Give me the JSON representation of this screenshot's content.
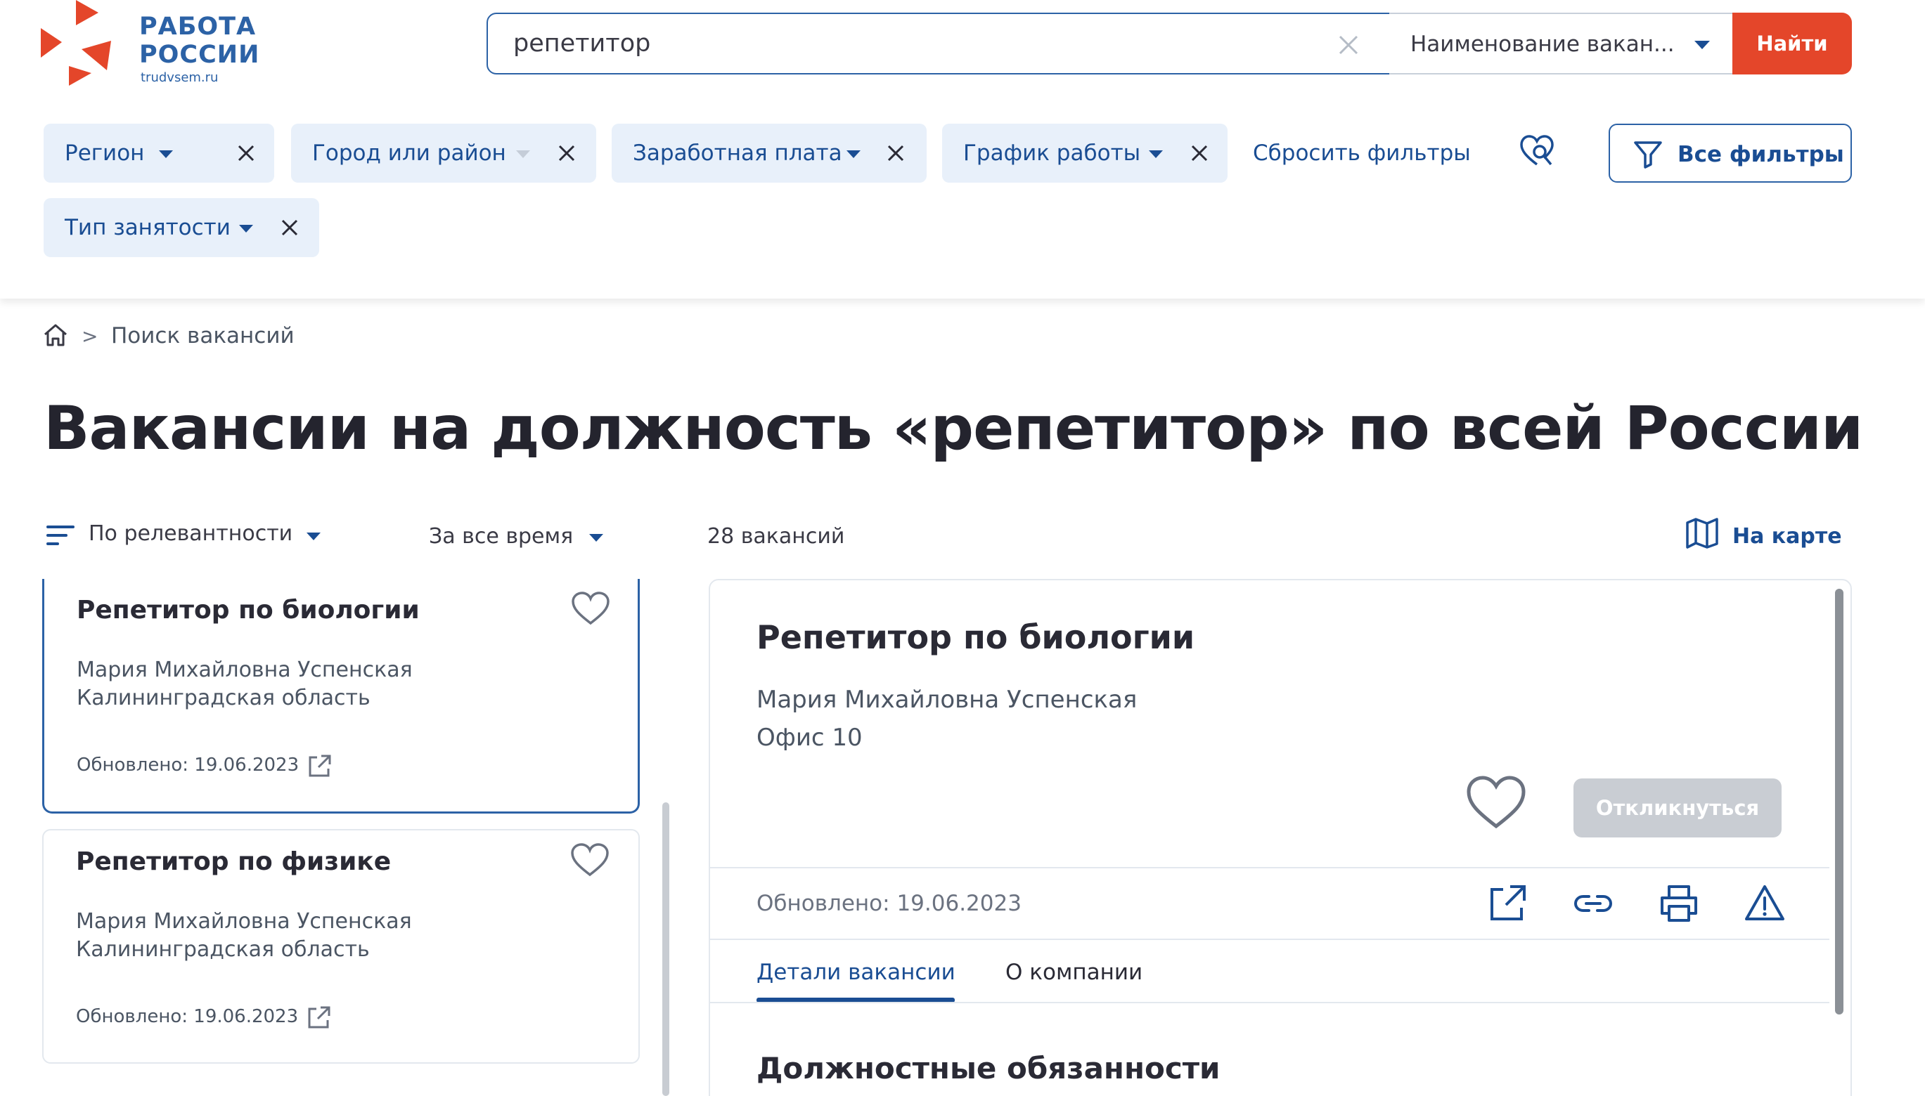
{
  "brand": {
    "line1": "РАБОТА",
    "line2": "РОССИИ",
    "domain": "trudvsem.ru",
    "accent": "#e4462a",
    "primary": "#2c62a6"
  },
  "search": {
    "value": "репетитор",
    "type_label": "Наименование вакан...",
    "button": "Найти"
  },
  "filters": {
    "chips": [
      {
        "label": "Регион"
      },
      {
        "label": "Город или район"
      },
      {
        "label": "Заработная плата"
      },
      {
        "label": "График работы"
      },
      {
        "label": "Тип занятости"
      }
    ],
    "reset": "Сбросить фильтры",
    "all": "Все фильтры"
  },
  "breadcrumb": {
    "current": "Поиск вакансий",
    "separator": ">"
  },
  "page_title": "Вакансии на должность «репетитор» по всей России",
  "controls": {
    "sort": "По релевантности",
    "period": "За все время",
    "count": "28 вакансий",
    "map": "На карте"
  },
  "vacancies": [
    {
      "title": "Репетитор по биологии",
      "company": "Мария Михайловна Успенская",
      "region": "Калининградская область",
      "updated": "Обновлено: 19.06.2023"
    },
    {
      "title": "Репетитор по физике",
      "company": "Мария Михайловна Успенская",
      "region": "Калининградская область",
      "updated": "Обновлено: 19.06.2023"
    }
  ],
  "detail": {
    "title": "Репетитор по биологии",
    "company": "Мария Михайловна Успенская",
    "office": "Офис 10",
    "respond": "Откликнуться",
    "updated": "Обновлено: 19.06.2023",
    "tabs": [
      "Детали вакансии",
      "О компании"
    ],
    "section": "Должностные обязанности"
  }
}
